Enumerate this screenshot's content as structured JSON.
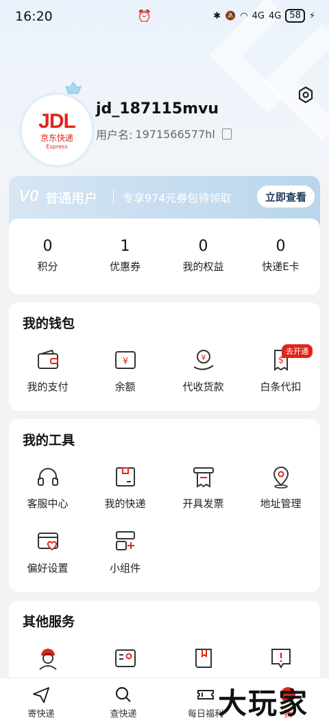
{
  "status_bar": {
    "time": "16:20",
    "network": "4G",
    "battery": "58"
  },
  "profile": {
    "logo_main": "JDL",
    "logo_cn": "京东快递",
    "logo_en": "Express",
    "username": "jd_187115mvu",
    "userid_label": "用户名:",
    "userid_value": "1971566577hl"
  },
  "vip": {
    "level": "V0",
    "name": "普通用户",
    "offer": "专享974元券包待领取",
    "button": "立即查看"
  },
  "stats": [
    {
      "value": "0",
      "label": "积分"
    },
    {
      "value": "1",
      "label": "优惠券"
    },
    {
      "value": "0",
      "label": "我的权益"
    },
    {
      "value": "0",
      "label": "快递E卡"
    }
  ],
  "wallet": {
    "title": "我的钱包",
    "items": [
      {
        "label": "我的支付",
        "icon": "wallet-icon"
      },
      {
        "label": "余额",
        "icon": "balance-icon"
      },
      {
        "label": "代收货款",
        "icon": "cod-icon"
      },
      {
        "label": "白条代扣",
        "icon": "receipt-icon"
      }
    ],
    "tag": "去开通"
  },
  "tools": {
    "title": "我的工具",
    "items": [
      {
        "label": "客服中心",
        "icon": "headset-icon"
      },
      {
        "label": "我的快递",
        "icon": "package-icon"
      },
      {
        "label": "开具发票",
        "icon": "invoice-icon"
      },
      {
        "label": "地址管理",
        "icon": "location-icon"
      },
      {
        "label": "偏好设置",
        "icon": "preference-icon"
      },
      {
        "label": "小组件",
        "icon": "widget-icon"
      }
    ]
  },
  "other": {
    "title": "其他服务",
    "items": [
      {
        "icon": "courier-icon"
      },
      {
        "icon": "id-card-icon"
      },
      {
        "icon": "book-icon"
      },
      {
        "icon": "alert-icon"
      }
    ]
  },
  "nav": [
    {
      "label": "寄快递",
      "icon": "send-icon"
    },
    {
      "label": "查快递",
      "icon": "search-icon"
    },
    {
      "label": "每日福利",
      "icon": "ticket-icon"
    },
    {
      "label": "我",
      "icon": "me-icon"
    }
  ],
  "watermark": "大玩家",
  "colors": {
    "accent": "#e1251b",
    "vip_bg": "#c4dcef"
  }
}
